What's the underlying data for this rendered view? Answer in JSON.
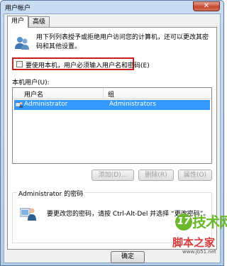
{
  "window": {
    "title": "用户帐户",
    "close_glyph": "✕"
  },
  "tabs": [
    {
      "label": "用户"
    },
    {
      "label": "高级"
    }
  ],
  "intro": {
    "text": "用下列列表授予或拒绝用户访问您的计算机，还可以更改其密码和其他设置。"
  },
  "auto_login": {
    "label": "要使用本机，用户必须输入用户名和密码(E)",
    "checked": false,
    "highlight_color": "#cc1d1d"
  },
  "users": {
    "label": "本机用户(U):",
    "columns": [
      "用户名",
      "组"
    ],
    "rows": [
      {
        "name": "Administrator",
        "group": "Administrators",
        "selected": true
      }
    ]
  },
  "buttons": {
    "add": "添加(D)...",
    "remove": "删除(R)",
    "properties": "属性(O)"
  },
  "password_group": {
    "title": "Administrator 的密码",
    "text": "要更改您的密码，请按 Ctrl-Alt-Del 并选择 “更改密码”。"
  },
  "dialog": {
    "ok": "确定"
  },
  "watermark": {
    "badge": "17",
    "brand": "技术网",
    "site": "脚本之家",
    "url": "www.jb51.net"
  },
  "colors": {
    "selection": "#3399ff",
    "title_bg": "#c9dcf2"
  }
}
